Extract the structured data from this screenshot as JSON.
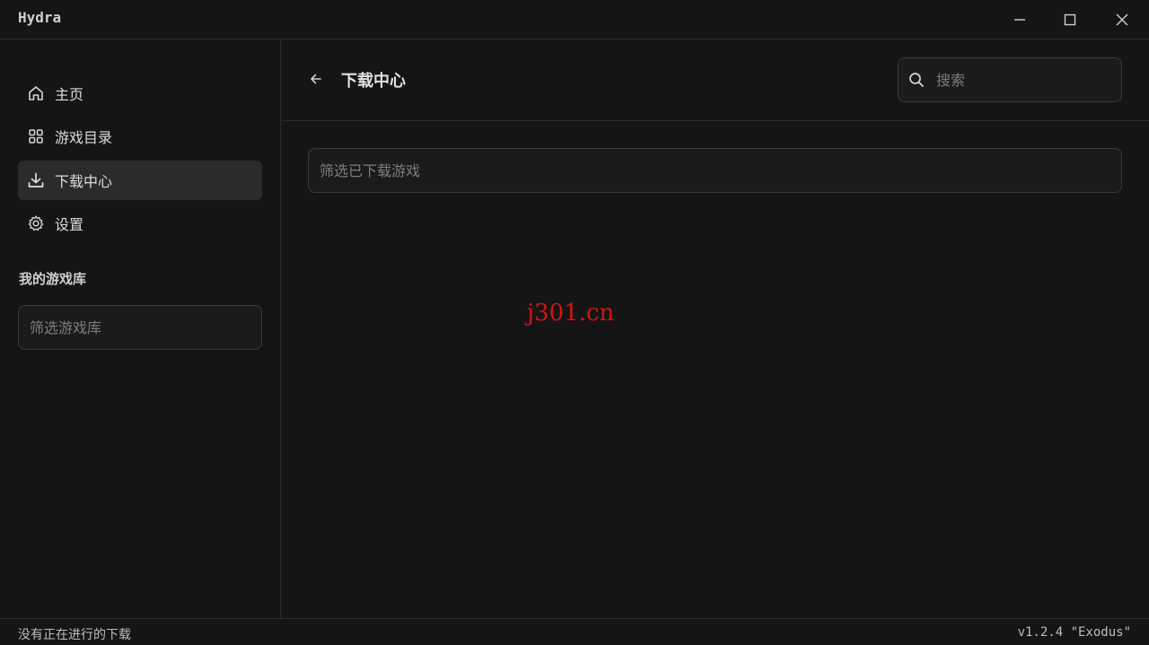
{
  "window": {
    "title": "Hydra",
    "controls": [
      "minimize",
      "maximize",
      "close"
    ]
  },
  "sidebar": {
    "items": [
      {
        "label": "主页",
        "icon": "home-icon",
        "active": false
      },
      {
        "label": "游戏目录",
        "icon": "grid-icon",
        "active": false
      },
      {
        "label": "下载中心",
        "icon": "download-icon",
        "active": true
      },
      {
        "label": "设置",
        "icon": "gear-icon",
        "active": false
      }
    ],
    "library_title": "我的游戏库",
    "library_filter_placeholder": "筛选游戏库"
  },
  "header": {
    "title": "下载中心",
    "search_placeholder": "搜索"
  },
  "main": {
    "filter_placeholder": "筛选已下载游戏"
  },
  "watermark": "j301.cn",
  "status": {
    "left": "没有正在进行的下载",
    "version": "v1.2.4 \"Exodus\""
  }
}
